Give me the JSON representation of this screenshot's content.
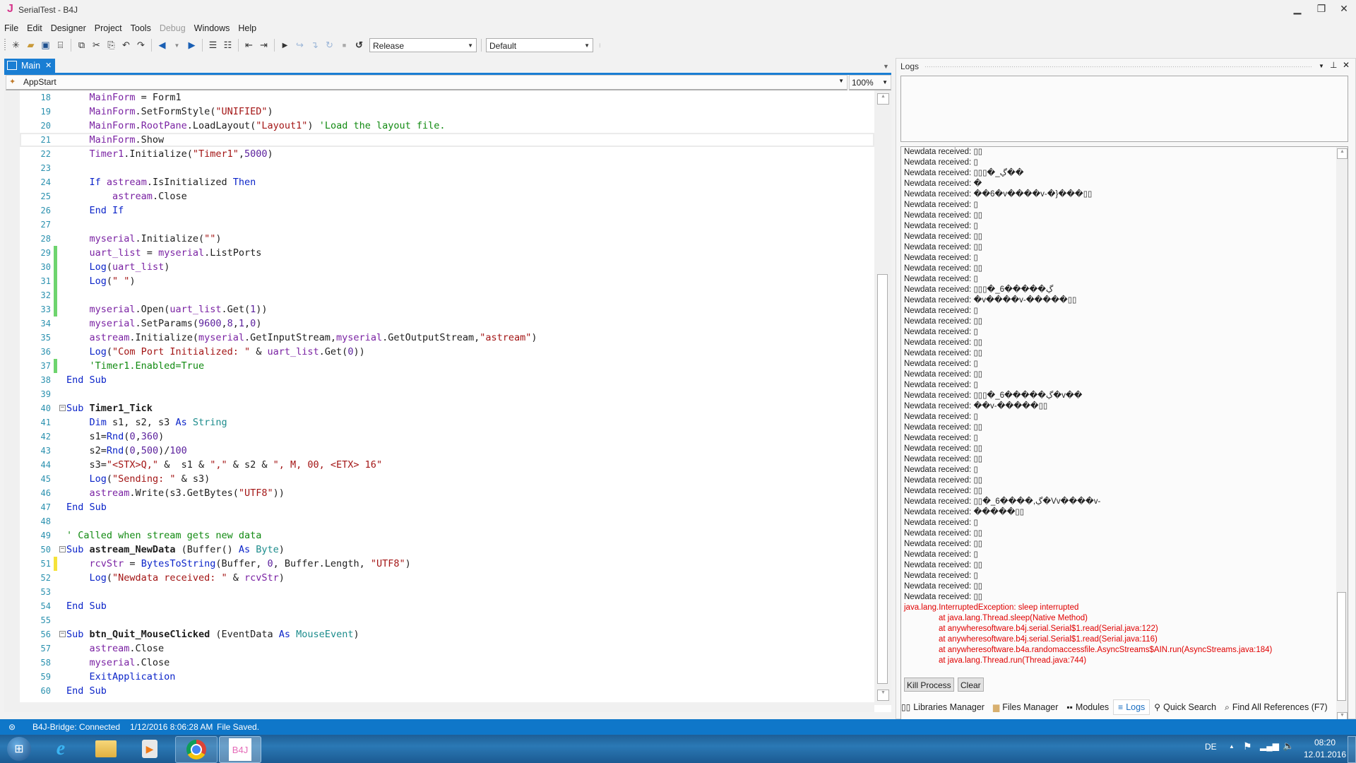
{
  "window": {
    "title": "SerialTest - B4J",
    "logo": "J",
    "controls": [
      "minimize-icon",
      "restore-icon",
      "close-icon"
    ],
    "accent": "#1a7ed3"
  },
  "menu": {
    "items": [
      {
        "label": "File",
        "enabled": true
      },
      {
        "label": "Edit",
        "enabled": true
      },
      {
        "label": "Designer",
        "enabled": true
      },
      {
        "label": "Project",
        "enabled": true
      },
      {
        "label": "Tools",
        "enabled": true
      },
      {
        "label": "Debug",
        "enabled": false
      },
      {
        "label": "Windows",
        "enabled": true
      },
      {
        "label": "Help",
        "enabled": true
      }
    ]
  },
  "toolbar": {
    "icons": [
      "new-file-icon",
      "open-folder-icon",
      "save-icon",
      "save-all-icon",
      "copy-icon",
      "cut-icon",
      "paste-icon",
      "undo-icon",
      "redo-icon",
      "navigate-back-icon",
      "navigate-dropdown-icon",
      "navigate-forward-icon",
      "comment-icon",
      "uncomment-icon",
      "outdent-icon",
      "indent-icon",
      "run-icon",
      "step-over-icon",
      "step-into-icon",
      "step-out-icon",
      "stop-icon",
      "restart-icon"
    ],
    "build_config": "Release",
    "build_target": "Default"
  },
  "editor": {
    "tab_label": "Main",
    "method_selector": "AppStart",
    "zoom": "100%",
    "current_line": 21,
    "lines": [
      {
        "n": "18",
        "html": "    <span class='id'>MainForm</span> = Form1"
      },
      {
        "n": "19",
        "html": "    <span class='id'>MainForm</span>.SetFormStyle(<span class='str'>\"UNIFIED\"</span>)"
      },
      {
        "n": "20",
        "html": "    <span class='id'>MainForm</span>.<span class='id'>RootPane</span>.LoadLayout(<span class='str'>\"Layout1\"</span>) <span class='cm'>'Load the layout file.</span>"
      },
      {
        "n": "21",
        "html": "    <span class='id'>MainForm</span>.Show"
      },
      {
        "n": "22",
        "html": "    <span class='id'>Timer1</span>.Initialize(<span class='str'>\"Timer1\"</span>,<span class='nm'>5000</span>)"
      },
      {
        "n": "23",
        "html": ""
      },
      {
        "n": "24",
        "html": "    <span class='kw'>If</span> <span class='id'>astream</span>.IsInitialized <span class='kw'>Then</span>"
      },
      {
        "n": "25",
        "html": "        <span class='id'>astream</span>.Close"
      },
      {
        "n": "26",
        "html": "    <span class='kw'>End If</span>"
      },
      {
        "n": "27",
        "html": ""
      },
      {
        "n": "28",
        "html": "    <span class='id'>myserial</span>.Initialize(<span class='str'>\"\"</span>)"
      },
      {
        "n": "29",
        "html": "    <span class='id'>uart_list</span> = <span class='id'>myserial</span>.ListPorts",
        "mark": "green"
      },
      {
        "n": "30",
        "html": "    <span class='kw'>Log</span>(<span class='id'>uart_list</span>)",
        "mark": "green"
      },
      {
        "n": "31",
        "html": "    <span class='kw'>Log</span>(<span class='str'>\" \"</span>)",
        "mark": "green"
      },
      {
        "n": "32",
        "html": "",
        "mark": "green"
      },
      {
        "n": "33",
        "html": "    <span class='id'>myserial</span>.Open(<span class='id'>uart_list</span>.Get(<span class='nm'>1</span>))",
        "mark": "green"
      },
      {
        "n": "34",
        "html": "    <span class='id'>myserial</span>.SetParams(<span class='nm'>9600</span>,<span class='nm'>8</span>,<span class='nm'>1</span>,<span class='nm'>0</span>)"
      },
      {
        "n": "35",
        "html": "    <span class='id'>astream</span>.Initialize(<span class='id'>myserial</span>.GetInputStream,<span class='id'>myserial</span>.GetOutputStream,<span class='str'>\"astream\"</span>)"
      },
      {
        "n": "36",
        "html": "    <span class='kw'>Log</span>(<span class='str'>\"Com Port Initialized: \"</span> &amp; <span class='id'>uart_list</span>.Get(<span class='nm'>0</span>))"
      },
      {
        "n": "37",
        "html": "    <span class='cm'>'Timer1.Enabled=True</span>",
        "mark": "green"
      },
      {
        "n": "38",
        "html": "<span class='kw'>End Sub</span>"
      },
      {
        "n": "39",
        "html": ""
      },
      {
        "n": "40",
        "html": "<span class='kw'>Sub</span> <span class='bold'>Timer1_Tick</span>",
        "fold": true
      },
      {
        "n": "41",
        "html": "    <span class='kw'>Dim</span> s1, s2, s3 <span class='kw'>As</span> <span class='ty'>String</span>"
      },
      {
        "n": "42",
        "html": "    s1=<span class='kw'>Rnd</span>(<span class='nm'>0</span>,<span class='nm'>360</span>)"
      },
      {
        "n": "43",
        "html": "    s2=<span class='kw'>Rnd</span>(<span class='nm'>0</span>,<span class='nm'>500</span>)/<span class='nm'>100</span>"
      },
      {
        "n": "44",
        "html": "    s3=<span class='str'>\"&lt;STX&gt;Q,\"</span> &amp;  s1 &amp; <span class='str'>\",\"</span> &amp; s2 &amp; <span class='str'>\", M, 00, &lt;ETX&gt; 16\"</span>"
      },
      {
        "n": "45",
        "html": "    <span class='kw'>Log</span>(<span class='str'>\"Sending: \"</span> &amp; s3)"
      },
      {
        "n": "46",
        "html": "    <span class='id'>astream</span>.Write(s3.GetBytes(<span class='str'>\"UTF8\"</span>))"
      },
      {
        "n": "47",
        "html": "<span class='kw'>End Sub</span>"
      },
      {
        "n": "48",
        "html": ""
      },
      {
        "n": "49",
        "html": "<span class='cm'>' Called when stream gets new data</span>"
      },
      {
        "n": "50",
        "html": "<span class='kw'>Sub</span> <span class='bold'>astream_NewData</span> (Buffer() <span class='kw'>As</span> <span class='ty'>Byte</span>)",
        "fold": true
      },
      {
        "n": "51",
        "html": "    <span class='id'>rcvStr</span> = <span class='kw'>BytesToString</span>(Buffer, <span class='nm'>0</span>, Buffer.Length, <span class='str'>\"UTF8\"</span>)",
        "mark": "yellow"
      },
      {
        "n": "52",
        "html": "    <span class='kw'>Log</span>(<span class='str'>\"Newdata received: \"</span> &amp; <span class='id'>rcvStr</span>)"
      },
      {
        "n": "53",
        "html": ""
      },
      {
        "n": "54",
        "html": "<span class='kw'>End Sub</span>"
      },
      {
        "n": "55",
        "html": ""
      },
      {
        "n": "56",
        "html": "<span class='kw'>Sub</span> <span class='bold'>btn_Quit_MouseClicked</span> (EventData <span class='kw'>As</span> <span class='ty'>MouseEvent</span>)",
        "fold": true
      },
      {
        "n": "57",
        "html": "    <span class='id'>astream</span>.Close"
      },
      {
        "n": "58",
        "html": "    <span class='id'>myserial</span>.Close"
      },
      {
        "n": "59",
        "html": "    <span class='kw'>ExitApplication</span>"
      },
      {
        "n": "60",
        "html": "<span class='kw'>End Sub</span>"
      }
    ]
  },
  "logs": {
    "title": "Logs",
    "entries": [
      {
        "t": "Newdata received: ▯▯"
      },
      {
        "t": "Newdata received: ▯"
      },
      {
        "t": "Newdata received: ▯▯▯�_ڲ��"
      },
      {
        "t": "Newdata received: �"
      },
      {
        "t": "Newdata received: ��6�v����v-�}���▯▯"
      },
      {
        "t": "Newdata received: ▯"
      },
      {
        "t": "Newdata received: ▯▯"
      },
      {
        "t": "Newdata received: ▯"
      },
      {
        "t": "Newdata received: ▯▯"
      },
      {
        "t": "Newdata received: ▯▯"
      },
      {
        "t": "Newdata received: ▯"
      },
      {
        "t": "Newdata received: ▯▯"
      },
      {
        "t": "Newdata received: ▯"
      },
      {
        "t": "Newdata received: ▯▯▯�_6�����ڲ"
      },
      {
        "t": "Newdata received: �v����v-�����▯▯"
      },
      {
        "t": "Newdata received: ▯"
      },
      {
        "t": "Newdata received: ▯▯"
      },
      {
        "t": "Newdata received: ▯"
      },
      {
        "t": "Newdata received: ▯▯"
      },
      {
        "t": "Newdata received: ▯▯"
      },
      {
        "t": "Newdata received: ▯"
      },
      {
        "t": "Newdata received: ▯▯"
      },
      {
        "t": "Newdata received: ▯"
      },
      {
        "t": "Newdata received: ▯▯▯�_6�����ڲ�v��"
      },
      {
        "t": "Newdata received: ��v-�����▯▯"
      },
      {
        "t": "Newdata received: ▯"
      },
      {
        "t": "Newdata received: ▯▯"
      },
      {
        "t": "Newdata received: ▯"
      },
      {
        "t": "Newdata received: ▯▯"
      },
      {
        "t": "Newdata received: ▯▯"
      },
      {
        "t": "Newdata received: ▯"
      },
      {
        "t": "Newdata received: ▯▯"
      },
      {
        "t": "Newdata received: ▯▯"
      },
      {
        "t": "Newdata received: ▯▯�_6����,ڲ�Vv����v-"
      },
      {
        "t": "Newdata received: �����▯▯"
      },
      {
        "t": "Newdata received: ▯"
      },
      {
        "t": "Newdata received: ▯▯"
      },
      {
        "t": "Newdata received: ▯▯"
      },
      {
        "t": "Newdata received: ▯"
      },
      {
        "t": "Newdata received: ▯▯"
      },
      {
        "t": "Newdata received: ▯"
      },
      {
        "t": "Newdata received: ▯▯"
      },
      {
        "t": "Newdata received: ▯▯"
      },
      {
        "t": "java.lang.InterruptedException: sleep interrupted",
        "err": true
      },
      {
        "t": "at java.lang.Thread.sleep(Native Method)",
        "err": true,
        "indent": true
      },
      {
        "t": "at anywheresoftware.b4j.serial.Serial$1.read(Serial.java:122)",
        "err": true,
        "indent": true
      },
      {
        "t": "at anywheresoftware.b4j.serial.Serial$1.read(Serial.java:116)",
        "err": true,
        "indent": true
      },
      {
        "t": "at anywheresoftware.b4a.randomaccessfile.AsyncStreams$AIN.run(AsyncStreams.java:184)",
        "err": true,
        "indent": true
      },
      {
        "t": "at java.lang.Thread.run(Thread.java:744)",
        "err": true,
        "indent": true
      }
    ],
    "kill_process_label": "Kill Process",
    "clear_label": "Clear",
    "error_color": "#e00000"
  },
  "bottom_tabs": [
    {
      "label": "Libraries Manager",
      "icon": "book-icon",
      "glyph": "▯▯",
      "active": false
    },
    {
      "label": "Files Manager",
      "icon": "folder-icon",
      "glyph": "▆",
      "active": false
    },
    {
      "label": "Modules",
      "icon": "modules-icon",
      "glyph": "▪▪",
      "active": false
    },
    {
      "label": "Logs",
      "icon": "logs-icon",
      "glyph": "≡",
      "active": true
    },
    {
      "label": "Quick Search",
      "icon": "search-icon",
      "glyph": "⚲",
      "active": false
    },
    {
      "label": "Find All References (F7)",
      "icon": "references-icon",
      "glyph": "⌕",
      "active": false
    }
  ],
  "status": {
    "bridge": "B4J-Bridge: Connected",
    "timestamp": "1/12/2016 8:06:28 AM",
    "message": "File Saved."
  },
  "taskbar": {
    "apps": [
      {
        "name": "start-button",
        "glyph": "⊞"
      },
      {
        "name": "internet-explorer-icon",
        "glyph": "e"
      },
      {
        "name": "file-explorer-icon",
        "glyph": "▭"
      },
      {
        "name": "media-player-icon",
        "glyph": "▶"
      },
      {
        "name": "chrome-icon",
        "glyph": "◉"
      },
      {
        "name": "b4j-icon",
        "glyph": "B4J"
      }
    ],
    "language": "DE",
    "time": "08:20",
    "date": "12.01.2016"
  }
}
